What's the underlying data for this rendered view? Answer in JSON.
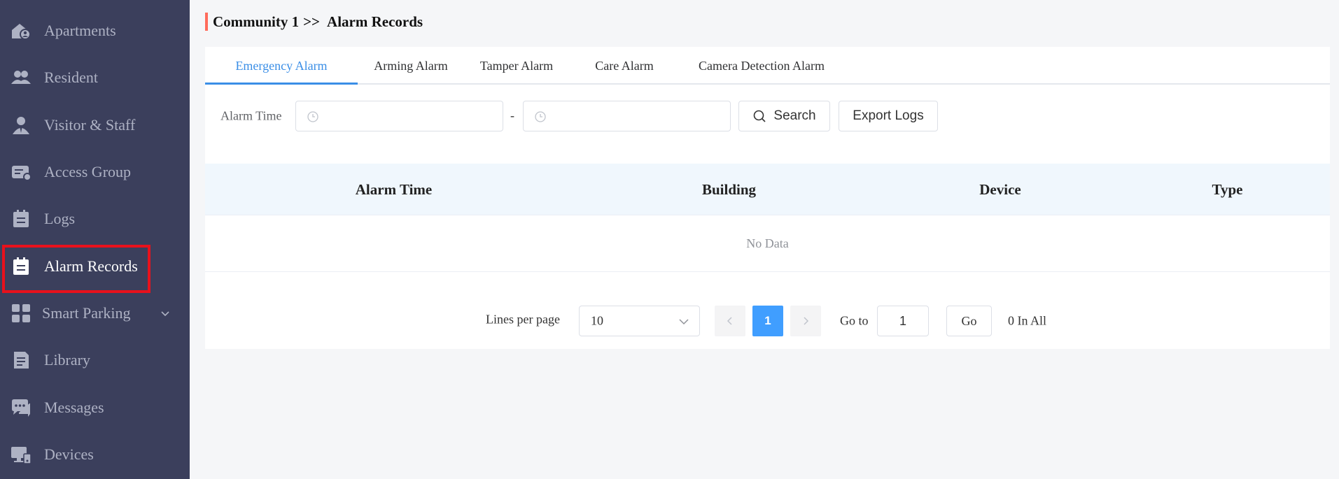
{
  "sidebar": {
    "items": [
      {
        "label": "Apartments",
        "icon": "apartments-icon"
      },
      {
        "label": "Resident",
        "icon": "resident-icon"
      },
      {
        "label": "Visitor & Staff",
        "icon": "visitor-staff-icon"
      },
      {
        "label": "Access Group",
        "icon": "access-group-icon"
      },
      {
        "label": "Logs",
        "icon": "logs-icon"
      },
      {
        "label": "Alarm Records",
        "icon": "alarm-records-icon",
        "active": true
      },
      {
        "label": "Smart Parking",
        "icon": "smart-parking-icon",
        "has_submenu": true
      },
      {
        "label": "Library",
        "icon": "library-icon"
      },
      {
        "label": "Messages",
        "icon": "messages-icon"
      },
      {
        "label": "Devices",
        "icon": "devices-icon"
      }
    ],
    "highlight_color": "#e8111c"
  },
  "breadcrumb": {
    "parent": "Community 1",
    "separator": ">>",
    "current": "Alarm Records"
  },
  "tabs": [
    {
      "label": "Emergency Alarm",
      "active": true
    },
    {
      "label": "Arming Alarm"
    },
    {
      "label": "Tamper Alarm"
    },
    {
      "label": "Care Alarm"
    },
    {
      "label": "Camera Detection Alarm"
    }
  ],
  "filter": {
    "label": "Alarm Time",
    "start_value": "",
    "end_value": "",
    "range_separator": "-",
    "search_label": "Search",
    "export_label": "Export Logs"
  },
  "table": {
    "columns": [
      "Alarm Time",
      "Building",
      "Device",
      "Type"
    ],
    "rows": [],
    "empty_text": "No Data"
  },
  "pagination": {
    "lines_per_page_label": "Lines per page",
    "lines_per_page_value": "10",
    "current_page": "1",
    "goto_label": "Go to",
    "goto_value": "1",
    "go_label": "Go",
    "total_text": "0 In All"
  },
  "colors": {
    "sidebar_bg": "#3b3f5c",
    "accent": "#409eff",
    "active_tab": "#3a8ee6",
    "breadcrumb_bar": "#ff6b5b"
  }
}
